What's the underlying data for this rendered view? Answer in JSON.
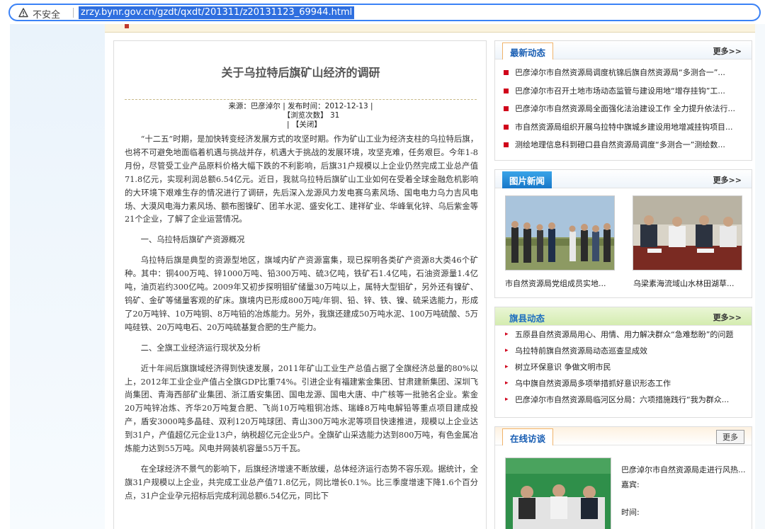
{
  "browser": {
    "security_label": "不安全",
    "url": "zrzy.bynr.gov.cn/gzdt/qxdt/201311/z20131123_69944.html"
  },
  "article": {
    "title": "关于乌拉特后旗矿山经济的调研",
    "meta_line1": "来源：巴彦淖尔  |  发布时间：2012-12-13  |",
    "meta_views": "【浏览次数】 31",
    "meta_close": "| 【关闭】",
    "paragraphs": [
      "“十二五”时期，是加快转变经济发展方式的攻坚时期。作为矿山工业为经济支柱的乌拉特后旗，也将不可避免地面临着机遇与挑战并存，机遇大于挑战的发展环境，攻坚克难，任务艰巨。今年1-8月份，尽管受工业产品原料价格大幅下跌的不利影响，后旗31户规模以上企业仍然完成工业总产值71.8亿元，实现利润总额6.54亿元。近日，我就乌拉特后旗矿山工业如何在受着全球金融危机影响的大环境下艰难生存的情况进行了调研，先后深入龙源风力发电赛乌素风场、国电电力乌力吉风电场、大漠风电海力素风场、额布图镍矿、团羊水泥、盛安化工、建祥矿业、华峰氧化锌、乌后紫金等21个企业，了解了企业运营情况。",
      "一、乌拉特后旗矿产资源概况",
      "乌拉特后旗是典型的资源型地区，旗域内矿产资源富集，现已探明各类矿产资源8大类46个矿种。其中：铜400万吨、锌1000万吨、铅300万吨、硫3亿吨，铁矿石1.4亿吨，石油资源量1.4亿吨，油页岩约300亿吨。2009年又初步探明钼矿储量30万吨以上，属特大型钼矿，另外还有镍矿、钨矿、金矿等储量客观的矿床。旗境内已形成800万吨/年铜、铅、锌、铁、镍、硫采选能力，形成了20万吨锌、10万吨铜、8万吨铅的冶炼能力。另外，我旗还建成50万吨水泥、100万吨硫酸、5万吨硅铁、20万吨电石、20万吨硫基复合肥的生产能力。",
      "二、全旗工业经济运行现状及分析",
      "近十年间后旗旗域经济得到快速发展，2011年矿山工业生产总值占据了全旗经济总量的80%以上，2012年工业企业产值占全旗GDP比重74%。引进企业有福建紫金集团、甘肃建新集团、深圳飞尚集团、青海西部矿业集团、浙江盾安集团、国电龙源、国电大唐、中广核等一批驰名企业。紫金20万吨锌冶炼、齐华20万吨复合肥、飞尚10万吨粗铜冶炼、瑞峰8万吨电解铅等重点项目建成投产，盾安3000吨多晶硅、双利120万吨球团、青山300万吨水泥等项目快速推进，规模以上企业达到31户，产值超亿元企业13户，纳税超亿元企业5户。全旗矿山采选能力达到800万吨，有色金属冶炼能力达到55万吨。风电并网装机容量55万千瓦。",
      "在全球经济不景气的影响下，后旗经济增速不断放缓，总体经济运行态势不容乐观。据统计，全旗31户规模以上企业，共完成工业总产值71.8亿元，同比增长0.1%。比三季度增速下降1.6个百分点，31户企业孕元招标后完成利润总额6.54亿元，同比下"
    ]
  },
  "latest": {
    "title": "最新动态",
    "more": "更多>>",
    "items": [
      "巴彦淖尔市自然资源局调度杭锦后旗自然资源局“多测合一”...",
      "巴彦淖尔市召开土地市场动态监管与建设用地“增存挂钩”工...",
      "巴彦淖尔市自然资源局全面强化法治建设工作 全力提升依法行...",
      "市自然资源局组织开展乌拉特中旗城乡建设用地增减挂钩项目...",
      "测绘地理信息科到磴口县自然资源局调度“多测合一”测绘数..."
    ]
  },
  "photo_news": {
    "title": "图片新闻",
    "more": "更多>>",
    "captions": [
      "市自然资源局党组成员实地...",
      "乌梁素海流域山水林田湖草..."
    ]
  },
  "county": {
    "title": "旗县动态",
    "more": "更多>>",
    "items": [
      "五原县自然资源局用心、用情、用力解决群众“急难愁盼”的问题",
      "乌拉特前旗自然资源局动态巡查显成效",
      "树立环保意识 争做文明市民",
      "乌中旗自然资源局多项举措抓好意识形态工作",
      "巴彦淖尔市自然资源局临河区分局：六项措施践行“我为群众..."
    ]
  },
  "online": {
    "title": "在线访谈",
    "more": "更多",
    "interview_title": "巴彦淖尔市自然资源局走进行风热...",
    "guest_label": "嘉宾:",
    "time_label": "时间:"
  },
  "colors": {
    "address_focus": "#3b82f6",
    "accent_red": "#d0021b",
    "heading_blue": "#1a5fb4"
  }
}
